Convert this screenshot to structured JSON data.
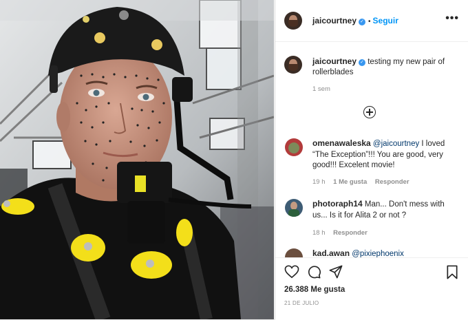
{
  "post": {
    "author": "jaicourtney",
    "follow_label": "Seguir",
    "dot": "•",
    "more_label": "•••",
    "caption_text": "testing my new pair of rollerblades",
    "caption_time": "1 sem"
  },
  "comments": [
    {
      "author": "omenawaleska",
      "mention": "@jaicourtney",
      "text": " I loved “The Exception”!!! You are good, very good!!! Excelent movie!",
      "time": "19 h",
      "likes": "1 Me gusta",
      "reply": "Responder"
    },
    {
      "author": "photoraph14",
      "mention": "",
      "text": " Man... Don't mess with us... Is it for Alita 2 or not ?",
      "time": "18 h",
      "likes": "",
      "reply": "Responder"
    },
    {
      "author": "kad.awan",
      "mention": "@pixiephoenix",
      "text": "",
      "time": "",
      "likes": "",
      "reply": ""
    }
  ],
  "actions": {
    "likes_count": "26.388 Me gusta",
    "date": "21 DE JULIO"
  },
  "icons": {
    "like": "heart-icon",
    "comment": "comment-icon",
    "share": "share-icon",
    "save": "bookmark-icon",
    "add_comment": "plus-circle-icon",
    "verified": "verified-badge-icon"
  },
  "colors": {
    "link": "#0095f6",
    "mention": "#00376b",
    "muted": "#8e8e8e",
    "verified": "#3897f0",
    "mocap_suit": "#111111",
    "mocap_pads": "#f3df1a"
  }
}
